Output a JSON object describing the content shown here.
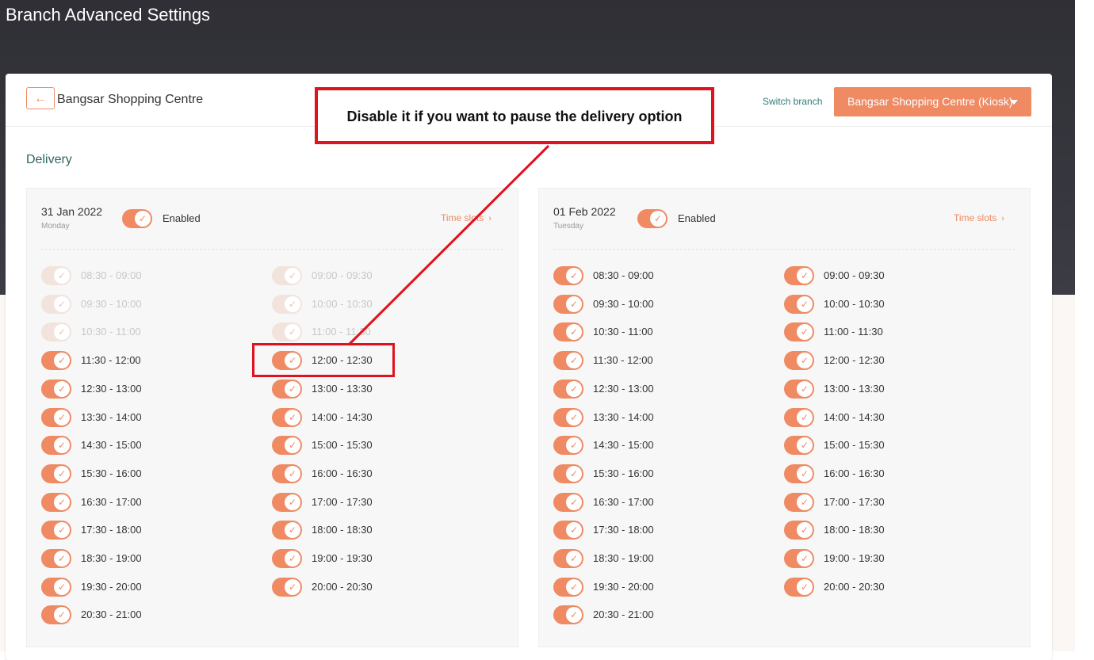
{
  "page": {
    "title": "Branch Advanced Settings"
  },
  "header": {
    "back_icon": "arrow-left-icon",
    "branch_name": "Bangsar Shopping Centre",
    "switch_label": "Switch branch",
    "selected_branch": "Bangsar Shopping Centre (Kiosk)"
  },
  "section": {
    "title": "Delivery"
  },
  "colors": {
    "accent": "#ef8a63",
    "annotation": "#e0121f",
    "hero": "#35363d"
  },
  "annotation": {
    "text": "Disable it if you want to pause the delivery option"
  },
  "days": [
    {
      "date": "31 Jan 2022",
      "weekday": "Monday",
      "status": "Enabled",
      "enabled": true,
      "timeslots_link": "Time slots",
      "slots": [
        {
          "label": "08:30 - 09:00",
          "enabled": false
        },
        {
          "label": "09:00 - 09:30",
          "enabled": false
        },
        {
          "label": "09:30 - 10:00",
          "enabled": false
        },
        {
          "label": "10:00 - 10:30",
          "enabled": false
        },
        {
          "label": "10:30 - 11:00",
          "enabled": false
        },
        {
          "label": "11:00 - 11:30",
          "enabled": false
        },
        {
          "label": "11:30 - 12:00",
          "enabled": true
        },
        {
          "label": "12:00 - 12:30",
          "enabled": true
        },
        {
          "label": "12:30 - 13:00",
          "enabled": true
        },
        {
          "label": "13:00 - 13:30",
          "enabled": true
        },
        {
          "label": "13:30 - 14:00",
          "enabled": true
        },
        {
          "label": "14:00 - 14:30",
          "enabled": true
        },
        {
          "label": "14:30 - 15:00",
          "enabled": true
        },
        {
          "label": "15:00 - 15:30",
          "enabled": true
        },
        {
          "label": "15:30 - 16:00",
          "enabled": true
        },
        {
          "label": "16:00 - 16:30",
          "enabled": true
        },
        {
          "label": "16:30 - 17:00",
          "enabled": true
        },
        {
          "label": "17:00 - 17:30",
          "enabled": true
        },
        {
          "label": "17:30 - 18:00",
          "enabled": true
        },
        {
          "label": "18:00 - 18:30",
          "enabled": true
        },
        {
          "label": "18:30 - 19:00",
          "enabled": true
        },
        {
          "label": "19:00 - 19:30",
          "enabled": true
        },
        {
          "label": "19:30 - 20:00",
          "enabled": true
        },
        {
          "label": "20:00 - 20:30",
          "enabled": true
        },
        {
          "label": "20:30 - 21:00",
          "enabled": true
        }
      ]
    },
    {
      "date": "01 Feb 2022",
      "weekday": "Tuesday",
      "status": "Enabled",
      "enabled": true,
      "timeslots_link": "Time slots",
      "slots": [
        {
          "label": "08:30 - 09:00",
          "enabled": true
        },
        {
          "label": "09:00 - 09:30",
          "enabled": true
        },
        {
          "label": "09:30 - 10:00",
          "enabled": true
        },
        {
          "label": "10:00 - 10:30",
          "enabled": true
        },
        {
          "label": "10:30 - 11:00",
          "enabled": true
        },
        {
          "label": "11:00 - 11:30",
          "enabled": true
        },
        {
          "label": "11:30 - 12:00",
          "enabled": true
        },
        {
          "label": "12:00 - 12:30",
          "enabled": true
        },
        {
          "label": "12:30 - 13:00",
          "enabled": true
        },
        {
          "label": "13:00 - 13:30",
          "enabled": true
        },
        {
          "label": "13:30 - 14:00",
          "enabled": true
        },
        {
          "label": "14:00 - 14:30",
          "enabled": true
        },
        {
          "label": "14:30 - 15:00",
          "enabled": true
        },
        {
          "label": "15:00 - 15:30",
          "enabled": true
        },
        {
          "label": "15:30 - 16:00",
          "enabled": true
        },
        {
          "label": "16:00 - 16:30",
          "enabled": true
        },
        {
          "label": "16:30 - 17:00",
          "enabled": true
        },
        {
          "label": "17:00 - 17:30",
          "enabled": true
        },
        {
          "label": "17:30 - 18:00",
          "enabled": true
        },
        {
          "label": "18:00 - 18:30",
          "enabled": true
        },
        {
          "label": "18:30 - 19:00",
          "enabled": true
        },
        {
          "label": "19:00 - 19:30",
          "enabled": true
        },
        {
          "label": "19:30 - 20:00",
          "enabled": true
        },
        {
          "label": "20:00 - 20:30",
          "enabled": true
        },
        {
          "label": "20:30 - 21:00",
          "enabled": true
        }
      ]
    }
  ]
}
